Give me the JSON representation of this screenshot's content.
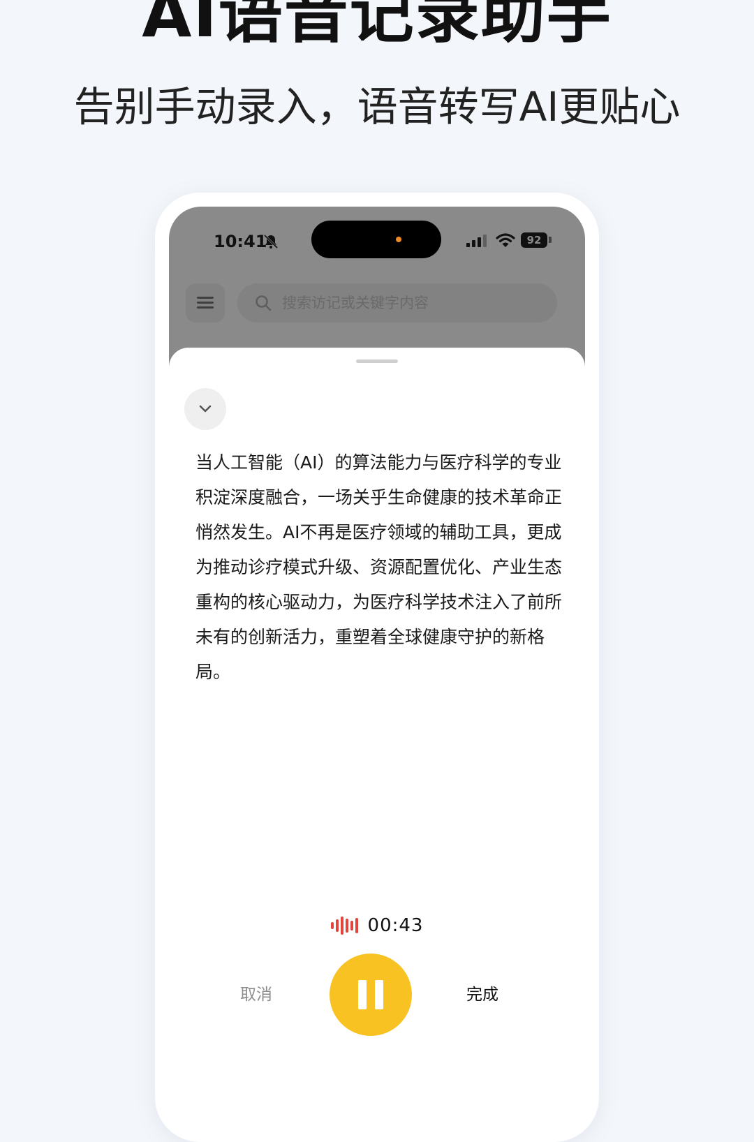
{
  "hero": {
    "title": "AI语音记录助手",
    "subtitle": "告别手动录入，语音转写AI更贴心"
  },
  "status_bar": {
    "time": "10:41",
    "battery": "92",
    "icons": [
      "bell-muted-icon",
      "signal-icon",
      "wifi-icon",
      "battery-icon"
    ]
  },
  "app_header": {
    "menu_icon": "menu-icon",
    "search_placeholder": "搜索访记或关键字内容"
  },
  "sheet": {
    "collapse_icon": "chevron-down-icon",
    "transcript": "当人工智能（AI）的算法能力与医疗科学的专业积淀深度融合，一场关乎生命健康的技术革命正悄然发生。AI不再是医疗领域的辅助工具，更成为推动诊疗模式升级、资源配置优化、产业生态重构的核心驱动力，为医疗科学技术注入了前所未有的创新活力，重塑着全球健康守护的新格局。",
    "recording_timer": "00:43",
    "cancel_label": "取消",
    "done_label": "完成",
    "pause_icon": "pause-icon"
  },
  "colors": {
    "accent": "#f8c222",
    "recording": "#e2453c",
    "background": "#f3f6fa",
    "overlay": "#8a8a8a"
  }
}
